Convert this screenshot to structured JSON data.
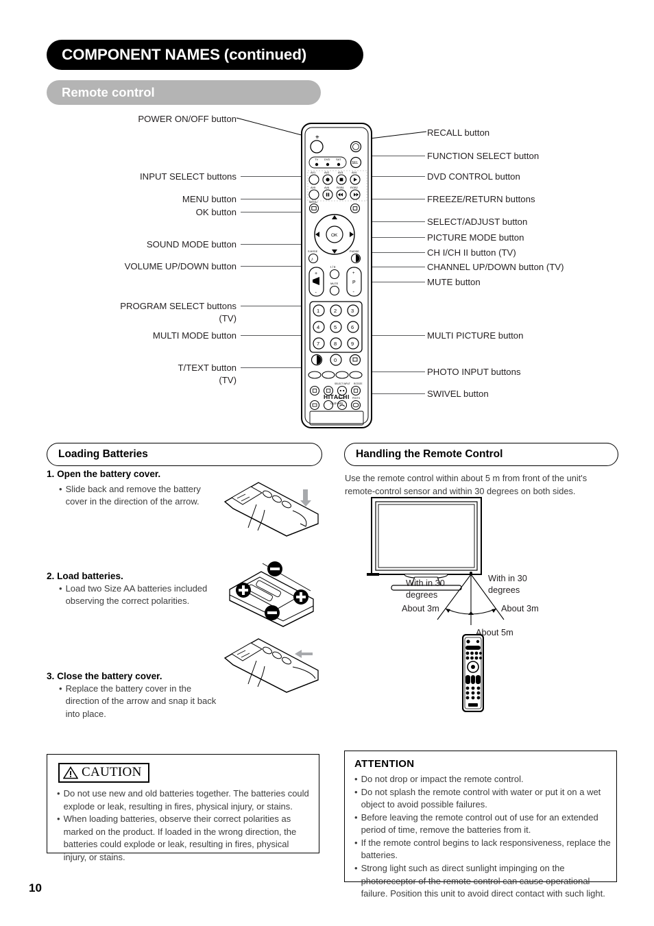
{
  "page": {
    "chapter_title": "COMPONENT NAMES (continued)",
    "section_title": "Remote control",
    "page_number": "10"
  },
  "callouts_left": [
    {
      "label": "POWER ON/OFF button"
    },
    {
      "label": "INPUT SELECT buttons"
    },
    {
      "label": "MENU button"
    },
    {
      "label": "OK button"
    },
    {
      "label": "SOUND MODE button"
    },
    {
      "label": "VOLUME UP/DOWN button"
    },
    {
      "label": "PROGRAM SELECT buttons"
    },
    {
      "label": "(TV)"
    },
    {
      "label": "MULTI MODE button"
    },
    {
      "label": "T/TEXT button"
    },
    {
      "label": "(TV)"
    }
  ],
  "callouts_right": [
    {
      "label": "RECALL button"
    },
    {
      "label": "FUNCTION SELECT button"
    },
    {
      "label": "DVD CONTROL button"
    },
    {
      "label": "FREEZE/RETURN buttons"
    },
    {
      "label": "SELECT/ADJUST button"
    },
    {
      "label": "PICTURE MODE button"
    },
    {
      "label": "CH I/CH II button (TV)"
    },
    {
      "label": "CHANNEL UP/DOWN button (TV)"
    },
    {
      "label": "MUTE button"
    },
    {
      "label": "MULTI PICTURE button"
    },
    {
      "label": "PHOTO INPUT buttons"
    },
    {
      "label": "SWIVEL button"
    }
  ],
  "remote": {
    "source_labels": [
      "TV",
      "DVD",
      "SAT"
    ],
    "input_labels_row1": [
      "AV1",
      "AV2",
      "AV3",
      "AV4"
    ],
    "input_labels_row2": [
      "AV5",
      "AV6",
      "RGB1",
      "RGB2"
    ],
    "menu_label": "MENU",
    "ok_label": "OK",
    "sound_label": "S.MODE",
    "picture_label": "P.MODE",
    "recall_label": "REC",
    "chi_chii_label": "I/II",
    "mute_label": "MUTE",
    "volume_plus": "+",
    "volume_minus": "-",
    "channel_plus": "+",
    "channel_minus": "-",
    "channel_letter": "P",
    "numpad": [
      "1",
      "2",
      "3",
      "4",
      "5",
      "6",
      "7",
      "8",
      "9",
      "0"
    ],
    "select_input_label": "SELECT INPUT",
    "rotate_label": "ROTATE",
    "swivel_label": "SWIVEL",
    "photo_label": "PHOTO",
    "brand": "HITACHI",
    "model": "CLE-949"
  },
  "loading_batteries": {
    "heading": "Loading Batteries",
    "steps": [
      {
        "title": "1. Open the battery cover.",
        "bullets": [
          "Slide back and remove the battery cover in the direction of the arrow."
        ]
      },
      {
        "title": "2. Load batteries.",
        "bullets": [
          "Load two Size AA batteries included observing the correct polarities."
        ]
      },
      {
        "title": "3. Close the battery cover.",
        "bullets": [
          "Replace the battery cover in the direction of the arrow and snap it back into place."
        ]
      }
    ]
  },
  "handling": {
    "heading": "Handling the Remote Control",
    "intro": "Use the remote control within about 5 m from front of the unit's remote-control sensor and within 30 degrees on both sides.",
    "labels": {
      "left_angle": "With in 30\ndegrees",
      "right_angle": "With in 30\ndegrees",
      "left_distance": "About 3m",
      "right_distance": "About 3m",
      "center_distance": "About 5m"
    }
  },
  "caution": {
    "title": "CAUTION",
    "items": [
      "Do not use new and old batteries together.  The batteries could explode or leak, resulting in fires, physical injury, or stains.",
      "When loading batteries, observe their correct polarities as marked on the product. If loaded in the wrong direction, the batteries could explode or leak, resulting in fires, physical injury, or stains."
    ]
  },
  "attention": {
    "title": "ATTENTION",
    "items": [
      "Do not drop or impact the remote control.",
      "Do not splash the remote control with water or put it on a wet object to avoid possible failures.",
      "Before leaving the remote control out of use for an extended period of time, remove the batteries from it.",
      "If the remote control begins to lack responsiveness, replace the batteries.",
      "Strong light such as direct sunlight impinging on the photoreceptor of the remote control can cause operational failure. Position this unit to avoid direct contact with such light."
    ]
  },
  "colors": {
    "chapter_bar": "#000000",
    "section_bar": "#b4b4b4",
    "text": "#231f20",
    "body_text": "#3b3b3b"
  }
}
